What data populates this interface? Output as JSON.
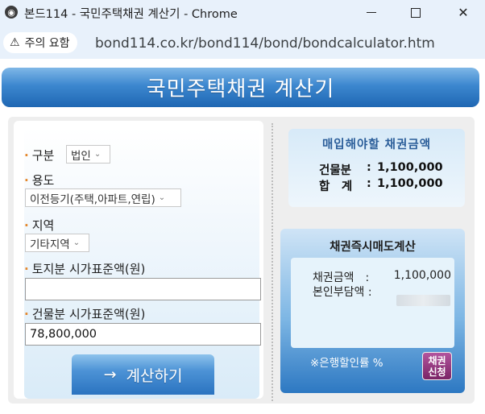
{
  "browser": {
    "window_title": "본드114 - 국민주택채권 계산기 - Chrome",
    "security_chip": "주의 요함",
    "url": "bond114.co.kr/bond114/bond/bondcalculator.htm",
    "icons": {
      "favicon": "globe-icon",
      "warning": "warning-triangle-icon"
    }
  },
  "page": {
    "banner_title": "국민주택채권 계산기",
    "form": {
      "category": {
        "label": "구분",
        "selected": "법인"
      },
      "purpose": {
        "label": "용도",
        "selected": "이전등기(주택,아파트,연립)"
      },
      "region": {
        "label": "지역",
        "selected": "기타지역"
      },
      "land_price": {
        "label": "토지분 시가표준액(원)",
        "value": ""
      },
      "building_price": {
        "label": "건물분 시가표준액(원)",
        "value": "78,800,000"
      },
      "calculate_button": {
        "arrow": "→",
        "label": "계산하기"
      }
    },
    "result": {
      "heading": "매입해야할 채권금액",
      "building": {
        "label": "건물분",
        "sep": ":",
        "value": "1,100,000"
      },
      "total": {
        "label": "합　계",
        "sep": ":",
        "value": "1,100,000"
      }
    },
    "immediate_sale": {
      "heading": "채권즉시매도계산",
      "bond_amount": {
        "label": "채권금액　:",
        "value": "1,100,000"
      },
      "self_pay": {
        "label": "본인부담액 :",
        "value": ""
      },
      "discount_note": "※은행할인률 %",
      "apply_button": [
        "채권",
        "신청"
      ]
    },
    "colors": {
      "banner": "#2f7cc6",
      "accent_dot": "#e4862a",
      "result_heading": "#2a5d99",
      "apply_button": "#8e2f7a"
    }
  }
}
